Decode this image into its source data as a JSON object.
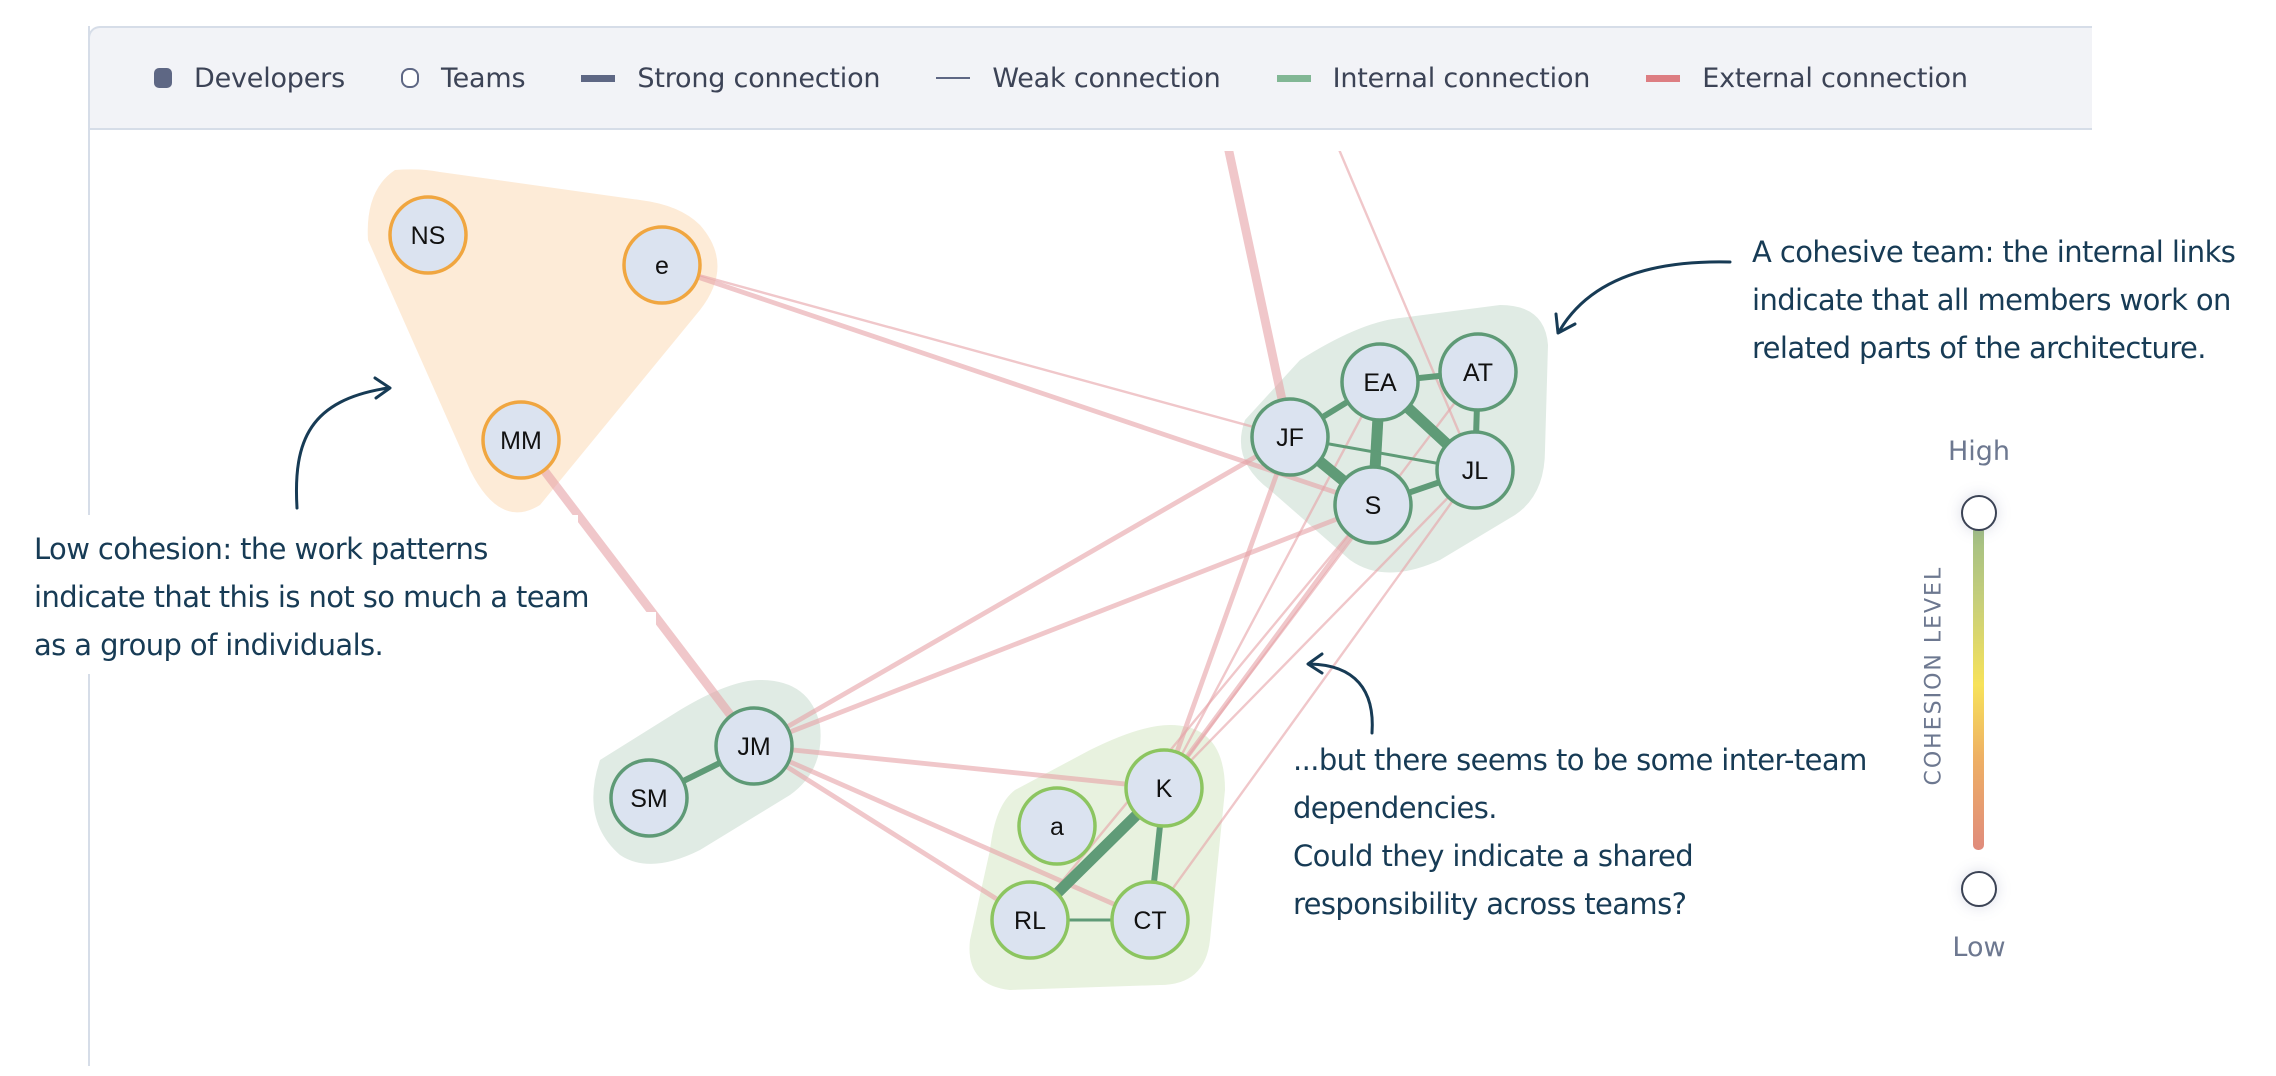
{
  "legend": {
    "items": [
      {
        "key": "developers",
        "label": "Developers",
        "icon": "filled-rounded-square-icon"
      },
      {
        "key": "teams",
        "label": "Teams",
        "icon": "hollow-circle-icon"
      },
      {
        "key": "strong",
        "label": "Strong connection",
        "icon": "thick-line-icon"
      },
      {
        "key": "weak",
        "label": "Weak connection",
        "icon": "thin-line-icon"
      },
      {
        "key": "internal",
        "label": "Internal connection",
        "icon": "green-line-icon"
      },
      {
        "key": "external",
        "label": "External connection",
        "icon": "red-line-icon"
      }
    ]
  },
  "colors": {
    "node_fill": "#dbe3f0",
    "internal_link": "#5f9b77",
    "external_link": "#e6a2a7",
    "annotation_text": "#173b55",
    "muted_text": "#6d7890"
  },
  "teams": [
    {
      "id": "team-orange",
      "cohesion": "low",
      "hull_color": "#fdebd7",
      "stroke_color": "#f0a640",
      "members": [
        "NS",
        "e",
        "MM"
      ]
    },
    {
      "id": "team-green",
      "cohesion": "high",
      "hull_color": "#e0ebe4",
      "stroke_color": "#5e9a76",
      "members": [
        "JF",
        "EA",
        "AT",
        "JL",
        "S"
      ]
    },
    {
      "id": "team-jm",
      "cohesion": "high",
      "hull_color": "#e0ebe4",
      "stroke_color": "#5e9a76",
      "members": [
        "JM",
        "SM"
      ]
    },
    {
      "id": "team-lightgreen",
      "cohesion": "medium-high",
      "hull_color": "#e8f2df",
      "stroke_color": "#8cc560",
      "members": [
        "K",
        "a",
        "RL",
        "CT"
      ]
    }
  ],
  "developers": [
    {
      "id": "NS",
      "label": "NS",
      "team": "team-orange"
    },
    {
      "id": "e",
      "label": "e",
      "team": "team-orange"
    },
    {
      "id": "MM",
      "label": "MM",
      "team": "team-orange"
    },
    {
      "id": "JF",
      "label": "JF",
      "team": "team-green"
    },
    {
      "id": "EA",
      "label": "EA",
      "team": "team-green"
    },
    {
      "id": "AT",
      "label": "AT",
      "team": "team-green"
    },
    {
      "id": "JL",
      "label": "JL",
      "team": "team-green"
    },
    {
      "id": "S",
      "label": "S",
      "team": "team-green"
    },
    {
      "id": "JM",
      "label": "JM",
      "team": "team-jm"
    },
    {
      "id": "SM",
      "label": "SM",
      "team": "team-jm"
    },
    {
      "id": "K",
      "label": "K",
      "team": "team-lightgreen"
    },
    {
      "id": "a",
      "label": "a",
      "team": "team-lightgreen"
    },
    {
      "id": "RL",
      "label": "RL",
      "team": "team-lightgreen"
    },
    {
      "id": "CT",
      "label": "CT",
      "team": "team-lightgreen"
    }
  ],
  "links": [
    {
      "source": "JF",
      "target": "EA",
      "type": "internal",
      "strength": "medium"
    },
    {
      "source": "EA",
      "target": "AT",
      "type": "internal",
      "strength": "medium"
    },
    {
      "source": "EA",
      "target": "JL",
      "type": "internal",
      "strength": "strong"
    },
    {
      "source": "EA",
      "target": "S",
      "type": "internal",
      "strength": "strong"
    },
    {
      "source": "AT",
      "target": "JL",
      "type": "internal",
      "strength": "medium"
    },
    {
      "source": "JF",
      "target": "JL",
      "type": "internal",
      "strength": "weak"
    },
    {
      "source": "JF",
      "target": "S",
      "type": "internal",
      "strength": "strong"
    },
    {
      "source": "S",
      "target": "JL",
      "type": "internal",
      "strength": "medium"
    },
    {
      "source": "JM",
      "target": "SM",
      "type": "internal",
      "strength": "medium"
    },
    {
      "source": "K",
      "target": "RL",
      "type": "internal",
      "strength": "strong"
    },
    {
      "source": "K",
      "target": "CT",
      "type": "internal",
      "strength": "medium"
    },
    {
      "source": "RL",
      "target": "CT",
      "type": "internal",
      "strength": "weak"
    },
    {
      "source": "e",
      "target": "JF",
      "type": "external",
      "strength": "weak"
    },
    {
      "source": "e",
      "target": "S",
      "type": "external",
      "strength": "medium"
    },
    {
      "source": "MM",
      "target": "JM",
      "type": "external",
      "strength": "strong"
    },
    {
      "source": "JM",
      "target": "JF",
      "type": "external",
      "strength": "medium"
    },
    {
      "source": "JM",
      "target": "S",
      "type": "external",
      "strength": "medium"
    },
    {
      "source": "JM",
      "target": "K",
      "type": "external",
      "strength": "medium"
    },
    {
      "source": "JM",
      "target": "RL",
      "type": "external",
      "strength": "medium"
    },
    {
      "source": "JM",
      "target": "CT",
      "type": "external",
      "strength": "medium"
    },
    {
      "source": "JF",
      "target": "JL",
      "type": "external",
      "strength": "weak"
    },
    {
      "source": "K",
      "target": "JF",
      "type": "external",
      "strength": "medium"
    },
    {
      "source": "K",
      "target": "EA",
      "type": "external",
      "strength": "weak"
    },
    {
      "source": "K",
      "target": "S",
      "type": "external",
      "strength": "medium"
    },
    {
      "source": "K",
      "target": "JL",
      "type": "external",
      "strength": "weak"
    },
    {
      "source": "K",
      "target": "AT",
      "type": "external",
      "strength": "weak"
    },
    {
      "source": "RL",
      "target": "S",
      "type": "external",
      "strength": "weak"
    },
    {
      "source": "CT",
      "target": "JL",
      "type": "external",
      "strength": "weak"
    },
    {
      "source": "offscreen-1",
      "target": "JF",
      "type": "external",
      "strength": "strong"
    },
    {
      "source": "offscreen-2",
      "target": "JL",
      "type": "external",
      "strength": "weak"
    }
  ],
  "annotations": {
    "cohesive": [
      "A cohesive team: the internal links",
      "indicate that all members work on",
      "related parts of the architecture."
    ],
    "low_cohesion": [
      "Low cohesion: the work patterns",
      "indicate that this is not so much a team",
      "as a group of individuals."
    ],
    "inter_team": [
      "...but there seems to be some inter-team",
      "dependencies.",
      "Could they indicate a shared",
      "responsibility across teams?"
    ]
  },
  "cohesion_scale": {
    "title": "COHESION LEVEL",
    "high_label": "High",
    "low_label": "Low"
  }
}
